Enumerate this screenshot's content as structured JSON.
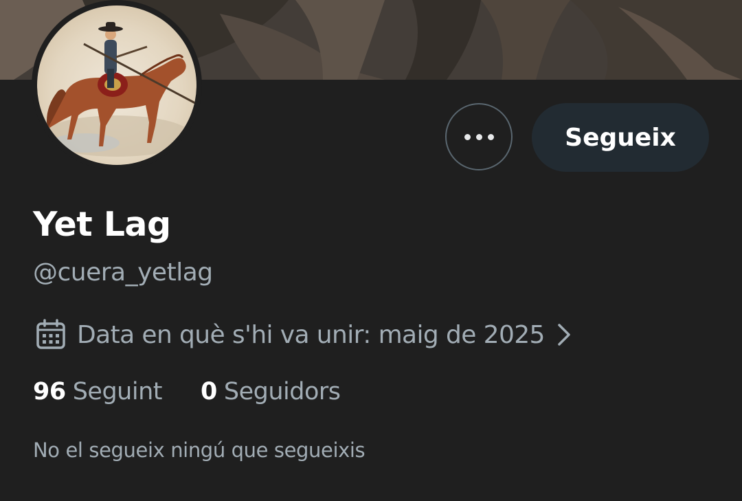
{
  "profile": {
    "display_name": "Yet Lag",
    "handle": "@cuera_yetlag",
    "joined_text": "Data en què s'hi va unir: maig de 2025",
    "following_count": "96",
    "following_label": "Seguint",
    "followers_count": "0",
    "followers_label": "Seguidors",
    "followers_you_know": "No el segueix ningú que segueixis"
  },
  "actions": {
    "follow_label": "Segueix",
    "more_icon": "more-horizontal-icon"
  },
  "icons": {
    "joined": "calendar-icon",
    "joined_chevron": "chevron-right-icon"
  },
  "colors": {
    "background": "#1f1f1f",
    "primary_text": "#ffffff",
    "secondary_text": "#a2adb5",
    "follow_button_bg": "#222b32",
    "outline": "#5a6770"
  }
}
